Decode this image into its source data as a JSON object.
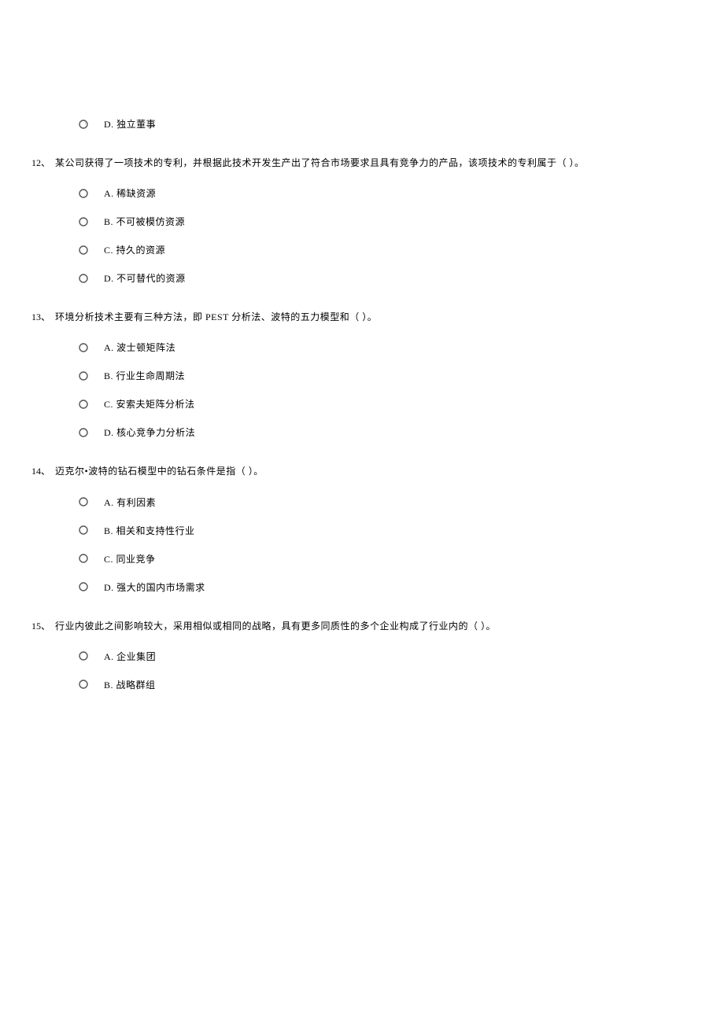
{
  "partial_option": {
    "label": "D.",
    "text": "独立董事"
  },
  "questions": [
    {
      "num": "12、",
      "text": "某公司获得了一项技术的专利，并根据此技术开发生产出了符合市场要求且具有竞争力的产品，该项技术的专利属于（ ）。",
      "options": [
        {
          "label": "A.",
          "text": "稀缺资源"
        },
        {
          "label": "B.",
          "text": "不可被模仿资源"
        },
        {
          "label": "C.",
          "text": "持久的资源"
        },
        {
          "label": "D.",
          "text": "不可替代的资源"
        }
      ]
    },
    {
      "num": "13、",
      "text": "环境分析技术主要有三种方法，即 PEST 分析法、波特的五力模型和（ ）。",
      "options": [
        {
          "label": "A.",
          "text": "波士顿矩阵法"
        },
        {
          "label": "B.",
          "text": "行业生命周期法"
        },
        {
          "label": "C.",
          "text": "安索夫矩阵分析法"
        },
        {
          "label": "D.",
          "text": "核心竞争力分析法"
        }
      ]
    },
    {
      "num": "14、",
      "text": "迈克尔•波特的钻石模型中的钻石条件是指（ ）。",
      "options": [
        {
          "label": "A.",
          "text": "有利因素"
        },
        {
          "label": "B.",
          "text": "相关和支持性行业"
        },
        {
          "label": "C.",
          "text": "同业竞争"
        },
        {
          "label": "D.",
          "text": "强大的国内市场需求"
        }
      ]
    },
    {
      "num": "15、",
      "text": "行业内彼此之间影响较大，采用相似或相同的战略，具有更多同质性的多个企业构成了行业内的（ ）。",
      "options": [
        {
          "label": "A.",
          "text": "企业集团"
        },
        {
          "label": "B.",
          "text": "战略群组"
        }
      ]
    }
  ]
}
